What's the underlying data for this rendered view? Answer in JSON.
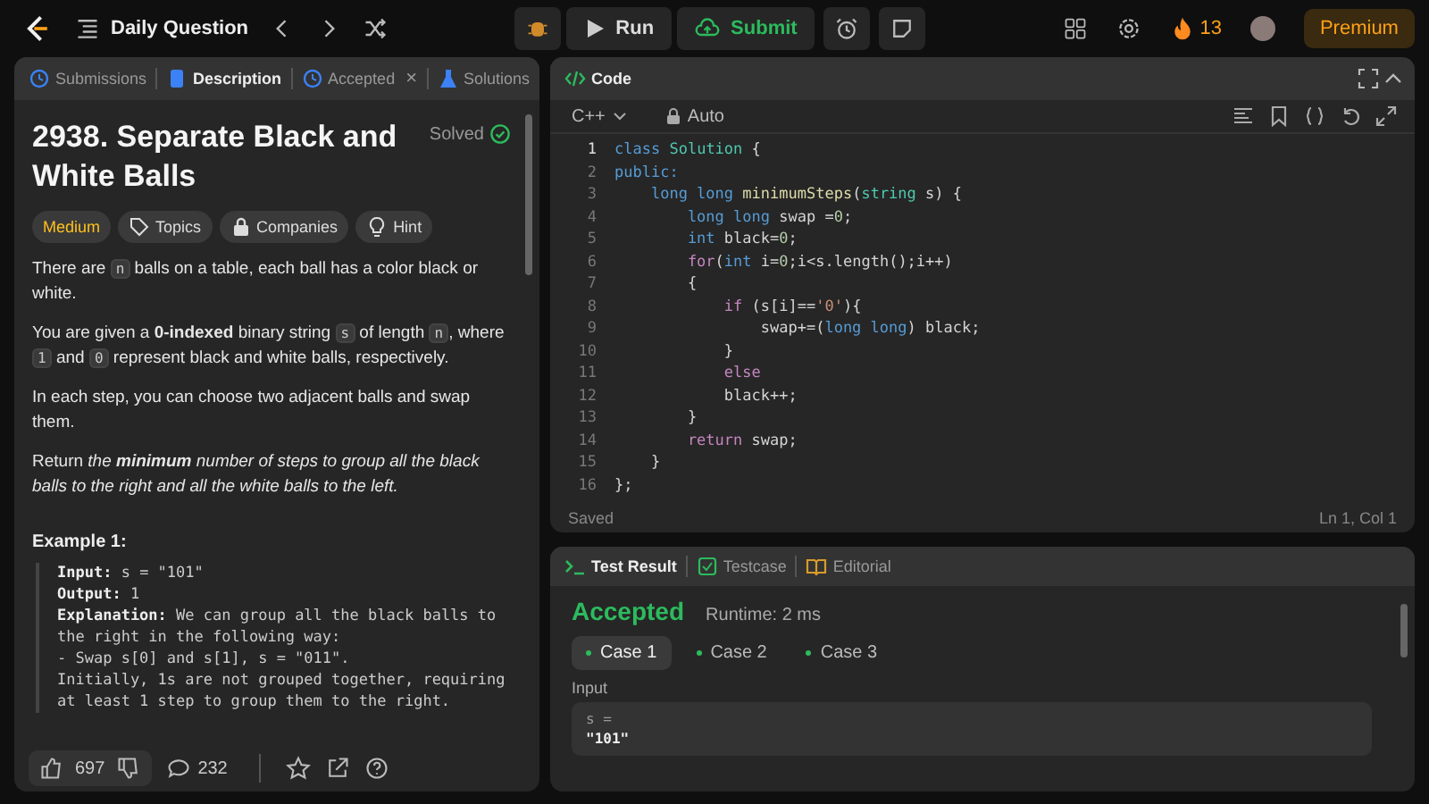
{
  "topbar": {
    "title": "Daily Question",
    "run": "Run",
    "submit": "Submit",
    "streak": "13",
    "premium": "Premium"
  },
  "left_tabs": [
    {
      "label": "Submissions",
      "kind": "clock",
      "selected": false,
      "closable": false
    },
    {
      "label": "Description",
      "kind": "doc",
      "selected": true,
      "closable": false
    },
    {
      "label": "Accepted",
      "kind": "clock",
      "selected": false,
      "closable": true
    },
    {
      "label": "Solutions",
      "kind": "flask",
      "selected": false,
      "closable": false
    }
  ],
  "close_glyph": "×",
  "problem": {
    "title": "2938. Separate Black and White Balls",
    "status": "Solved",
    "tags": [
      {
        "label": "Medium",
        "kind": "difficulty"
      },
      {
        "label": "Topics",
        "kind": "topics"
      },
      {
        "label": "Companies",
        "kind": "companies"
      },
      {
        "label": "Hint",
        "kind": "hint"
      }
    ],
    "paragraphs": [
      [
        {
          "t": "There are ",
          "kind": "text"
        },
        {
          "t": "n",
          "kind": "code"
        },
        {
          "t": " balls on a table, each ball has a color black or white.",
          "kind": "text"
        }
      ],
      [
        {
          "t": "You are given a ",
          "kind": "text"
        },
        {
          "t": "0-indexed",
          "kind": "bold"
        },
        {
          "t": " binary string ",
          "kind": "text"
        },
        {
          "t": "s",
          "kind": "code"
        },
        {
          "t": " of length ",
          "kind": "text"
        },
        {
          "t": "n",
          "kind": "code"
        },
        {
          "t": ", where ",
          "kind": "text"
        },
        {
          "t": "1",
          "kind": "code"
        },
        {
          "t": " and ",
          "kind": "text"
        },
        {
          "t": "0",
          "kind": "code"
        },
        {
          "t": " represent black and white balls, respectively.",
          "kind": "text"
        }
      ],
      [
        {
          "t": "In each step, you can choose two adjacent balls and swap them.",
          "kind": "text"
        }
      ],
      [
        {
          "t": "Return ",
          "kind": "text"
        },
        {
          "t": "the ",
          "kind": "italic"
        },
        {
          "t": "minimum",
          "kind": "bolditalic"
        },
        {
          "t": " number of steps to group all the black balls to the right and all the white balls to the left.",
          "kind": "italic"
        }
      ]
    ],
    "example_title": "Example 1:",
    "example_lines": [
      {
        "label": "Input:",
        "text": " s = \"101\""
      },
      {
        "label": "Output:",
        "text": " 1"
      },
      {
        "label": "Explanation:",
        "text": " We can group all the black balls to the right in the following way:"
      },
      {
        "text": "- Swap s[0] and s[1], s = \"011\"."
      },
      {
        "text": "Initially, 1s are not grouped together, requiring at least 1 step to group them to the right."
      }
    ]
  },
  "footer": {
    "likes": "697",
    "comments": "232"
  },
  "code_panel": {
    "title": "Code",
    "language": "C++",
    "mode": "Auto",
    "status": "Saved",
    "cursor": "Ln 1, Col 1",
    "lines": [
      {
        "num": "1",
        "current": true,
        "tokens": [
          {
            "t": "class ",
            "kind": "kw"
          },
          {
            "t": "Solution",
            "kind": "type"
          },
          {
            "t": " {",
            "kind": "plain"
          }
        ]
      },
      {
        "num": "2",
        "current": false,
        "tokens": [
          {
            "t": "public:",
            "kind": "kw"
          }
        ]
      },
      {
        "num": "3",
        "current": false,
        "tokens": [
          {
            "t": "    long long ",
            "kind": "kw"
          },
          {
            "t": "minimumSteps",
            "kind": "fn"
          },
          {
            "t": "(",
            "kind": "plain"
          },
          {
            "t": "string",
            "kind": "type"
          },
          {
            "t": " s) {",
            "kind": "plain"
          }
        ]
      },
      {
        "num": "4",
        "current": false,
        "tokens": [
          {
            "t": "        long long ",
            "kind": "kw"
          },
          {
            "t": "swap =",
            "kind": "plain"
          },
          {
            "t": "0",
            "kind": "num"
          },
          {
            "t": ";",
            "kind": "plain"
          }
        ]
      },
      {
        "num": "5",
        "current": false,
        "tokens": [
          {
            "t": "        int ",
            "kind": "kw"
          },
          {
            "t": "black=",
            "kind": "plain"
          },
          {
            "t": "0",
            "kind": "num"
          },
          {
            "t": ";",
            "kind": "plain"
          }
        ]
      },
      {
        "num": "6",
        "current": false,
        "tokens": [
          {
            "t": "        for",
            "kind": "ctl"
          },
          {
            "t": "(",
            "kind": "plain"
          },
          {
            "t": "int ",
            "kind": "kw"
          },
          {
            "t": "i=",
            "kind": "plain"
          },
          {
            "t": "0",
            "kind": "num"
          },
          {
            "t": ";i<s.length();i++)",
            "kind": "plain"
          }
        ]
      },
      {
        "num": "7",
        "current": false,
        "tokens": [
          {
            "t": "        {",
            "kind": "plain"
          }
        ]
      },
      {
        "num": "8",
        "current": false,
        "tokens": [
          {
            "t": "            if ",
            "kind": "ctl"
          },
          {
            "t": "(s[i]==",
            "kind": "plain"
          },
          {
            "t": "'0'",
            "kind": "str"
          },
          {
            "t": "){",
            "kind": "plain"
          }
        ]
      },
      {
        "num": "9",
        "current": false,
        "tokens": [
          {
            "t": "                swap+=(",
            "kind": "plain"
          },
          {
            "t": "long long",
            "kind": "kw"
          },
          {
            "t": ") black;",
            "kind": "plain"
          }
        ]
      },
      {
        "num": "10",
        "current": false,
        "tokens": [
          {
            "t": "            }",
            "kind": "plain"
          }
        ]
      },
      {
        "num": "11",
        "current": false,
        "tokens": [
          {
            "t": "            else",
            "kind": "ctl"
          }
        ]
      },
      {
        "num": "12",
        "current": false,
        "tokens": [
          {
            "t": "            black++;",
            "kind": "plain"
          }
        ]
      },
      {
        "num": "13",
        "current": false,
        "tokens": [
          {
            "t": "        }",
            "kind": "plain"
          }
        ]
      },
      {
        "num": "14",
        "current": false,
        "tokens": [
          {
            "t": "        return ",
            "kind": "ctl"
          },
          {
            "t": "swap;",
            "kind": "plain"
          }
        ]
      },
      {
        "num": "15",
        "current": false,
        "tokens": [
          {
            "t": "    }",
            "kind": "plain"
          }
        ]
      },
      {
        "num": "16",
        "current": false,
        "tokens": [
          {
            "t": "};",
            "kind": "plain"
          }
        ]
      }
    ]
  },
  "test_tabs": [
    {
      "label": "Test Result",
      "kind": "terminal",
      "selected": true
    },
    {
      "label": "Testcase",
      "kind": "check",
      "selected": false
    },
    {
      "label": "Editorial",
      "kind": "book",
      "selected": false
    }
  ],
  "result": {
    "verdict": "Accepted",
    "runtime": "Runtime: 2 ms",
    "cases": [
      {
        "label": "Case 1",
        "selected": true,
        "color": "#2cbb5d"
      },
      {
        "label": "Case 2",
        "selected": false,
        "color": "#2cbb5d"
      },
      {
        "label": "Case 3",
        "selected": false,
        "color": "#2cbb5d"
      }
    ],
    "input_label": "Input",
    "var_name": "s =",
    "var_value": "\"101\""
  }
}
